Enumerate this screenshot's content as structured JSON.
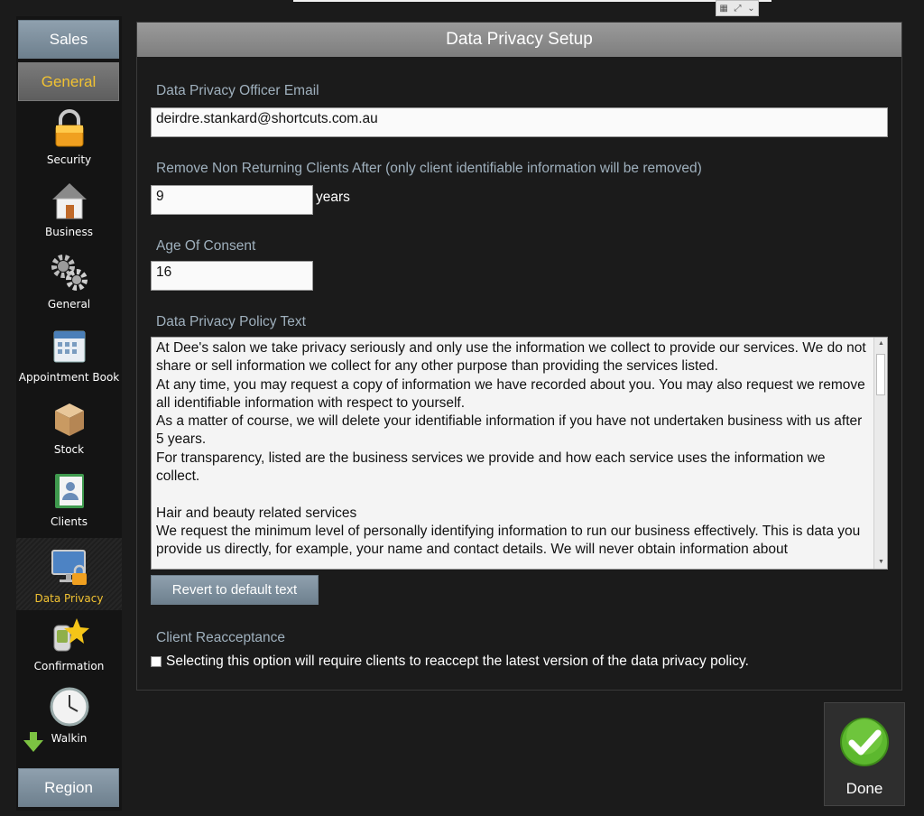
{
  "sidebar": {
    "sales_label": "Sales",
    "general_label": "General",
    "region_label": "Region",
    "items": [
      {
        "label": "Security",
        "icon": "padlock-icon"
      },
      {
        "label": "Business",
        "icon": "house-icon"
      },
      {
        "label": "General",
        "icon": "gears-icon"
      },
      {
        "label": "Appointment Book",
        "icon": "calendar-icon"
      },
      {
        "label": "Stock",
        "icon": "box-icon"
      },
      {
        "label": "Clients",
        "icon": "address-book-icon"
      },
      {
        "label": "Data Privacy",
        "icon": "monitor-lock-icon",
        "active": true
      },
      {
        "label": "Confirmation",
        "icon": "phone-star-icon"
      },
      {
        "label": "Walkin",
        "icon": "clock-icon"
      }
    ]
  },
  "panel": {
    "title": "Data Privacy Setup",
    "email_label": "Data Privacy Officer Email",
    "email_value": "deirdre.stankard@shortcuts.com.au",
    "remove_label": "Remove Non Returning Clients After (only client identifiable information will be removed)",
    "remove_value": "9",
    "remove_unit": "years",
    "age_label": "Age Of Consent",
    "age_value": "16",
    "policy_label": "Data Privacy Policy Text",
    "policy_lines": [
      "At Dee's salon we take privacy seriously and only use the information we collect to provide our services. We do not share or sell information we collect for any other purpose than providing the services listed.",
      "At any time, you may request a copy of information we have recorded about you. You may also request we remove all identifiable information with respect to yourself.",
      "As a matter of course, we will delete your identifiable information if you have not undertaken business with us after 5 years.",
      "For transparency, listed are the business services we provide and how each service uses the information we collect.",
      "",
      "Hair and beauty related services",
      "We request the minimum level of personally identifying information to run our business effectively. This is data you provide us directly, for example, your name and contact details. We will never obtain information about"
    ],
    "revert_label": "Revert to default text",
    "reaccept_label": "Client Reacceptance",
    "reaccept_text": "Selecting this option will require clients to reaccept the latest version of the data privacy policy."
  },
  "done_label": "Done",
  "colors": {
    "accent": "#f1c232",
    "button": "#7f909e",
    "label": "#9fb0bd",
    "done_check": "#5cb82e"
  }
}
